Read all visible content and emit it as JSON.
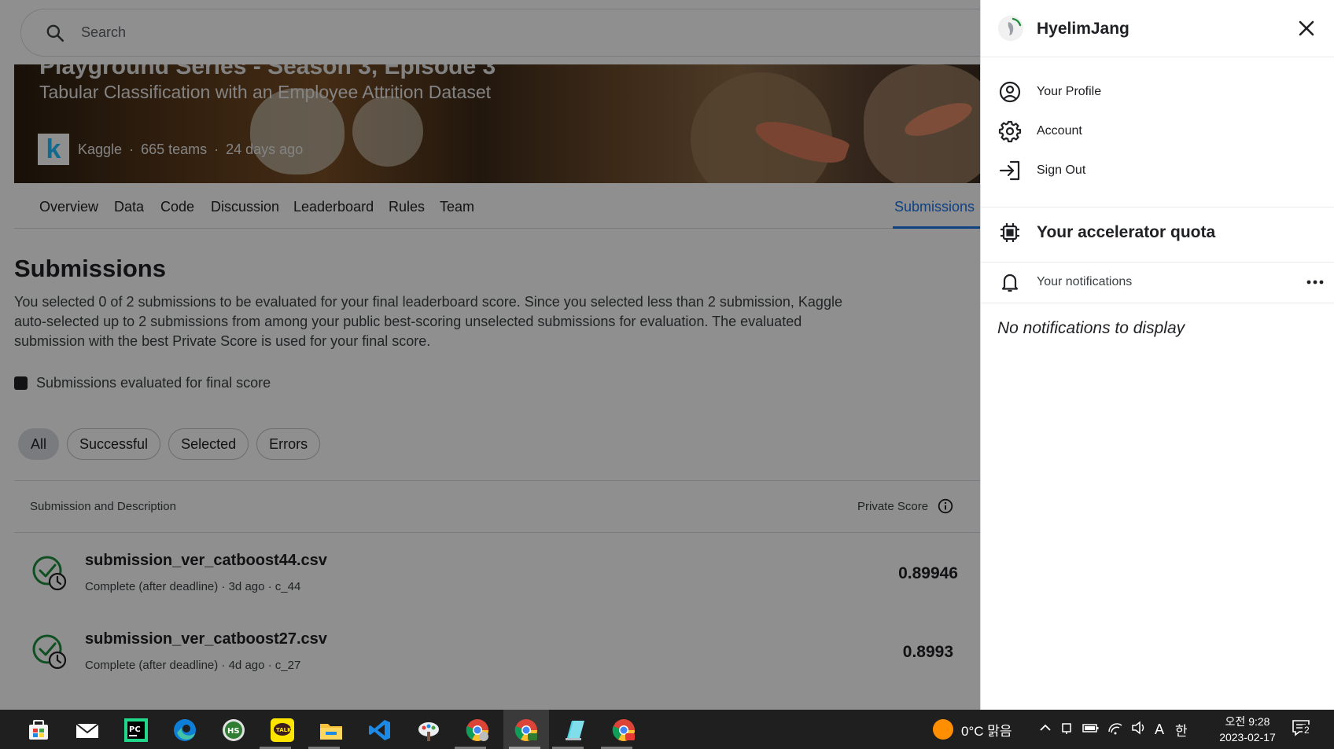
{
  "search": {
    "placeholder": "Search"
  },
  "banner": {
    "cut_title": "Playground Series - Season 3, Episode 3",
    "subtitle": "Tabular Classification with an Employee Attrition Dataset",
    "logo_letter": "k",
    "host": "Kaggle",
    "teams": "665 teams",
    "age": "24 days ago",
    "separator": "·"
  },
  "tabs": [
    {
      "label": "Overview"
    },
    {
      "label": "Data"
    },
    {
      "label": "Code"
    },
    {
      "label": "Discussion"
    },
    {
      "label": "Leaderboard"
    },
    {
      "label": "Rules"
    },
    {
      "label": "Team"
    },
    {
      "label": "Submissions",
      "active": true
    }
  ],
  "page": {
    "title": "Submissions",
    "description": "You selected 0 of 2 submissions to be evaluated for your final leaderboard score. Since you selected less than 2 submission, Kaggle auto-selected up to 2 submissions from among your public best-scoring unselected submissions for evaluation. The evaluated submission with the best Private Score is used for your final score.",
    "legend": "Submissions evaluated for final score"
  },
  "filters": [
    {
      "label": "All",
      "active": true
    },
    {
      "label": "Successful"
    },
    {
      "label": "Selected"
    },
    {
      "label": "Errors"
    }
  ],
  "table": {
    "col_left": "Submission and Description",
    "col_right": "Private Score",
    "rows": [
      {
        "name": "submission_ver_catboost44.csv",
        "meta": "Complete (after deadline) · 3d ago · c_44",
        "score": "0.89946"
      },
      {
        "name": "submission_ver_catboost27.csv",
        "meta": "Complete (after deadline) · 4d ago · c_27",
        "score": "0.8993"
      }
    ]
  },
  "drawer": {
    "username": "HyelimJang",
    "menu": [
      {
        "label": "Your Profile",
        "icon": "user-circle-icon"
      },
      {
        "label": "Account",
        "icon": "gear-icon"
      },
      {
        "label": "Sign Out",
        "icon": "sign-out-icon"
      }
    ],
    "quota": "Your accelerator quota",
    "notifications": "Your notifications",
    "empty": "No notifications to display"
  },
  "taskbar": {
    "weather": "0°C 맑음",
    "ime_letter": "A",
    "ime_lang": "한",
    "time": "오전 9:28",
    "date": "2023-02-17",
    "notif_count": "2"
  },
  "colors": {
    "accent": "#1a73e8",
    "success": "#1e8e3e",
    "kaggle": "#20beff"
  }
}
